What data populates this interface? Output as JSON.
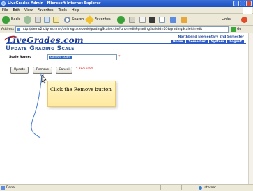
{
  "window": {
    "title": "LiveGrades Admin - Microsoft Internet Explorer"
  },
  "menu": {
    "items": [
      "File",
      "Edit",
      "View",
      "Favorites",
      "Tools",
      "Help"
    ]
  },
  "toolbar": {
    "back_label": "Back",
    "search_label": "Search",
    "favorites_label": "Favorites",
    "links_label": "Links"
  },
  "address": {
    "label": "Address",
    "url": "http://demo2.citymsh.net/onlinegradebook/gradingScales.cfm?uno=edit&gradingScaleId=55&gradingScaleId=edit",
    "go_label": "Go"
  },
  "site": {
    "logo": "LiveGrades.com",
    "school_name": "Northbend Elementary  2nd Semester",
    "nav": [
      "Home",
      "Semester",
      "System",
      "Logout"
    ]
  },
  "page": {
    "title": "Update Grading Scale",
    "scale_name_label": "Scale Name:",
    "scale_name_value": "college scale",
    "required_star": "*",
    "buttons": {
      "update": "Update",
      "remove": "Remove",
      "cancel": "Cancel"
    },
    "required_note": "* Required"
  },
  "tutorial": {
    "callout_text": "Click the Remove button"
  },
  "status": {
    "text": "Done",
    "zone": "Internet"
  }
}
